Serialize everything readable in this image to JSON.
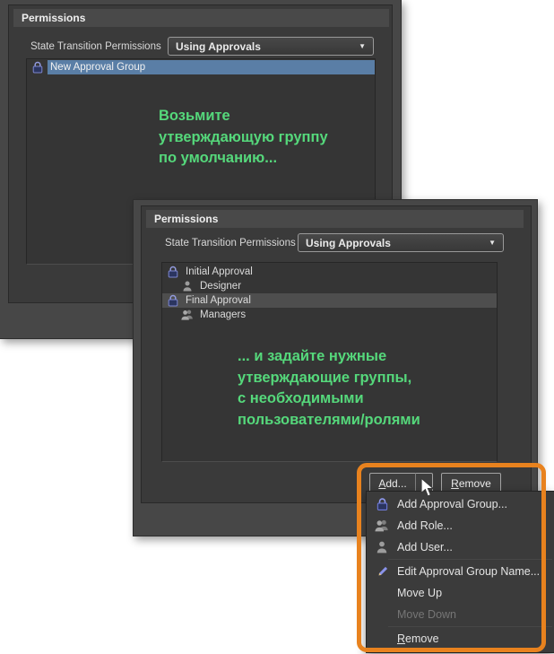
{
  "colors": {
    "accent_orange": "#E8821E",
    "annotation_green": "#55D87B",
    "selection_blue": "#5A7EA6",
    "window_bg": "#474747",
    "panel_bg": "#3A3A3A"
  },
  "window1": {
    "group_title": "Permissions",
    "field_label": "State Transition Permissions",
    "dropdown_value": "Using Approvals",
    "rows": [
      {
        "label": "New Approval Group",
        "icon": "approval-group",
        "selected": true
      }
    ],
    "annotation": "Возьмите\nутверждающую группу\nпо умолчанию..."
  },
  "window2": {
    "group_title": "Permissions",
    "field_label": "State Transition Permissions",
    "dropdown_value": "Using Approvals",
    "rows": [
      {
        "label": "Initial Approval",
        "icon": "approval-group",
        "selected": false
      },
      {
        "label": "Designer",
        "icon": "user",
        "selected": false
      },
      {
        "label": "Final Approval",
        "icon": "approval-group",
        "selected": true
      },
      {
        "label": "Managers",
        "icon": "role",
        "selected": false
      }
    ],
    "annotation": "... и задайте нужные\nутверждающие группы,\nс необходимыми\nпользователями/ролями",
    "add_button": "Add...",
    "remove_button": "Remove"
  },
  "menu": {
    "items": [
      {
        "label": "Add Approval Group...",
        "icon": "approval-group"
      },
      {
        "label": "Add Role...",
        "icon": "role"
      },
      {
        "label": "Add User...",
        "icon": "user"
      },
      {
        "label": "Edit Approval Group Name...",
        "icon": "pencil"
      },
      {
        "label": "Move Up"
      },
      {
        "label": "Move Down",
        "disabled": true
      },
      {
        "label": "Remove"
      }
    ]
  }
}
